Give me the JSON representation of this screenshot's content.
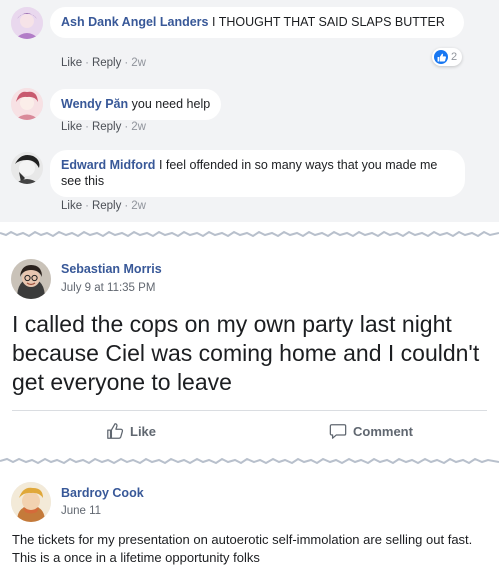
{
  "colors": {
    "link_blue": "#385898",
    "comment_bg": "#f2f3f5",
    "like_blue": "#1877f2",
    "muted_text": "#90949c"
  },
  "comments": [
    {
      "author": "Ash Dank Angel Landers",
      "text": "I THOUGHT THAT SAID SLAPS BUTTER",
      "like_label": "Like",
      "reply_label": "Reply",
      "time": "2w",
      "reaction_icon": "like-reaction-icon",
      "reaction_count": "2"
    },
    {
      "author": "Wendy Păn",
      "text": "you need help",
      "like_label": "Like",
      "reply_label": "Reply",
      "time": "2w"
    },
    {
      "author": "Edward Midford",
      "text": "I feel offended in so many ways that you made me see this",
      "like_label": "Like",
      "reply_label": "Reply",
      "time": "2w"
    }
  ],
  "post1": {
    "author": "Sebastian Morris",
    "date": "July 9 at 11:35 PM",
    "text": "I called the cops on my own party last night because Ciel was coming home and I couldn't get everyone to leave",
    "like_label": "Like",
    "comment_label": "Comment",
    "like_icon": "thumbs-up-icon",
    "comment_icon": "comment-bubble-icon"
  },
  "post2": {
    "author": "Bardroy Cook",
    "date": "June 11",
    "text": "The tickets for my presentation on autoerotic self-immolation are selling out fast. This is a once in a lifetime opportunity folks"
  }
}
